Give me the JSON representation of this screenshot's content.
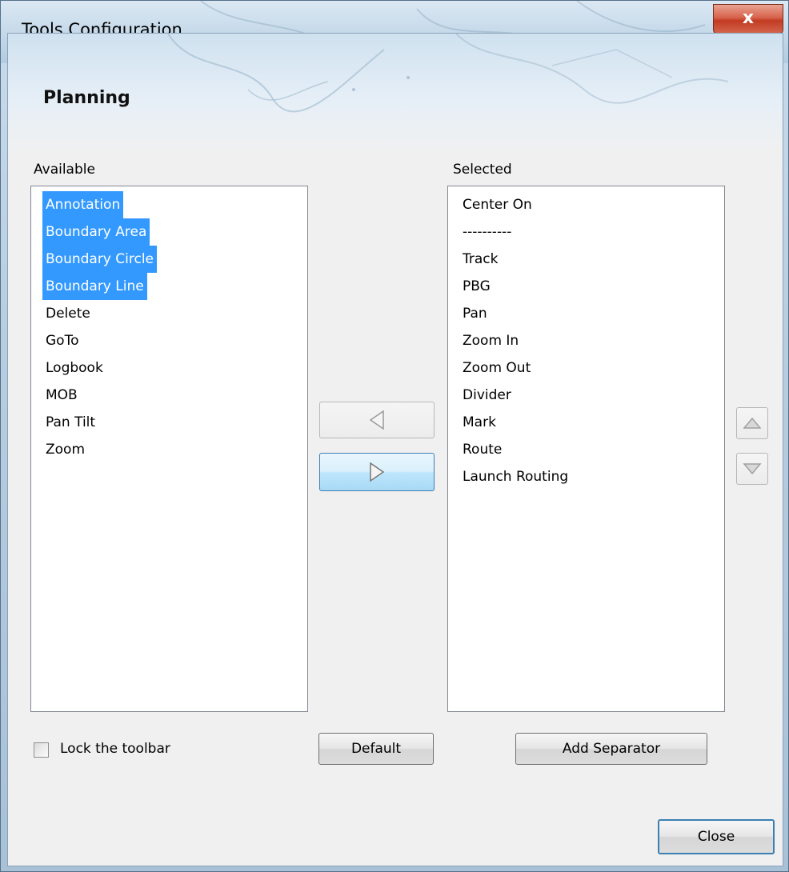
{
  "window": {
    "title": "Tools Configuration",
    "close_glyph": "x"
  },
  "banner": {
    "heading": "Planning"
  },
  "available": {
    "label": "Available",
    "items": [
      {
        "label": "Annotation",
        "selected": true
      },
      {
        "label": "Boundary Area",
        "selected": true
      },
      {
        "label": "Boundary Circle",
        "selected": true
      },
      {
        "label": "Boundary Line",
        "selected": true
      },
      {
        "label": "Delete",
        "selected": false
      },
      {
        "label": "GoTo",
        "selected": false
      },
      {
        "label": "Logbook",
        "selected": false
      },
      {
        "label": "MOB",
        "selected": false
      },
      {
        "label": "Pan Tilt",
        "selected": false
      },
      {
        "label": "Zoom",
        "selected": false
      }
    ]
  },
  "selected": {
    "label": "Selected",
    "items": [
      {
        "label": "Center On"
      },
      {
        "label": "----------"
      },
      {
        "label": "Track"
      },
      {
        "label": "PBG"
      },
      {
        "label": "Pan"
      },
      {
        "label": "Zoom In"
      },
      {
        "label": "Zoom Out"
      },
      {
        "label": "Divider"
      },
      {
        "label": "Mark"
      },
      {
        "label": "Route"
      },
      {
        "label": "Launch Routing"
      }
    ]
  },
  "buttons": {
    "remove_icon": "left-triangle-icon",
    "add_icon": "right-triangle-icon",
    "move_up_icon": "up-triangle-icon",
    "move_down_icon": "down-triangle-icon",
    "default": "Default",
    "add_separator": "Add Separator",
    "close": "Close"
  },
  "lock": {
    "label": "Lock the toolbar",
    "checked": false
  },
  "colors": {
    "selection": "#3399ff",
    "close_red": "#c23b22",
    "hot_blue": "#bee6fd"
  }
}
